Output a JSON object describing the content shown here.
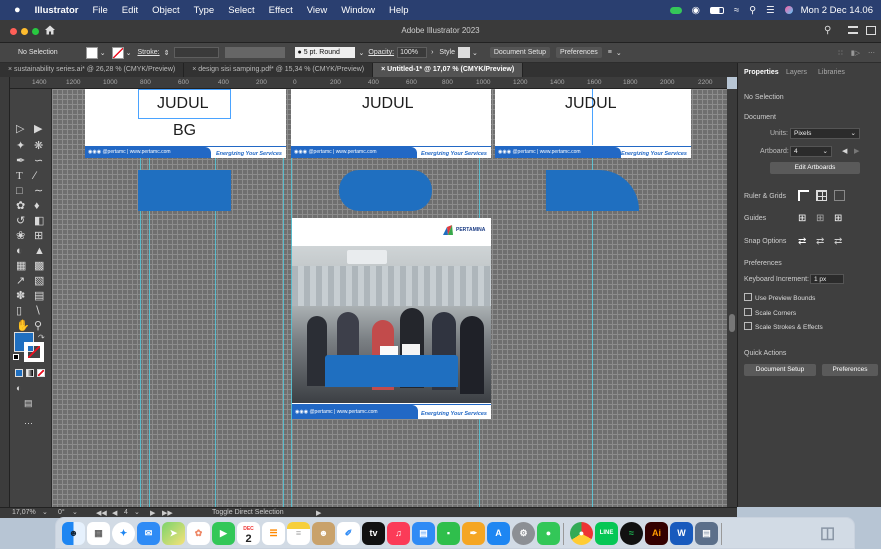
{
  "menubar": {
    "apple": "",
    "app_name": "Illustrator",
    "items": [
      "File",
      "Edit",
      "Object",
      "Type",
      "Select",
      "Effect",
      "View",
      "Window",
      "Help"
    ],
    "clock": "Mon 2 Dec 14.06"
  },
  "window": {
    "title": "Adobe Illustrator 2023"
  },
  "control_bar": {
    "selection": "No Selection",
    "stroke_label": "Stroke:",
    "brush": "5 pt. Round",
    "opacity_label": "Opacity:",
    "opacity_value": "100%",
    "style_label": "Style",
    "document_setup": "Document Setup",
    "preferences": "Preferences"
  },
  "tabs": [
    {
      "label": "sustainability series.ai* @ 26,28 % (CMYK/Preview)",
      "active": false
    },
    {
      "label": "design sisi samping.pdf* @ 15,34 % (CMYK/Preview)",
      "active": false
    },
    {
      "label": "Untitled-1* @ 17,07 % (CMYK/Preview)",
      "active": true
    }
  ],
  "ruler_labels": [
    "1400",
    "1200",
    "1000",
    "800",
    "600",
    "400",
    "200",
    "0",
    "200",
    "400",
    "600",
    "800",
    "1000",
    "1200",
    "1400",
    "1600",
    "1800",
    "2000",
    "2200"
  ],
  "artboards": {
    "top1_line1": "JUDUL",
    "top1_line2": "BG",
    "top2_text": "JUDUL",
    "top3_text": "JUDUL",
    "footer_social": "@pertamc | www.pertamc.com",
    "footer_tagline": "Energizing Your Services",
    "logo_text": "PERTAMINA"
  },
  "panel": {
    "tabs": [
      "Properties",
      "Layers",
      "Libraries"
    ],
    "no_selection": "No Selection",
    "document": "Document",
    "units_label": "Units:",
    "units_value": "Pixels",
    "artboard_label": "Artboard:",
    "artboard_value": "4",
    "edit_artboards": "Edit Artboards",
    "ruler_grids": "Ruler & Grids",
    "guides": "Guides",
    "snap_options": "Snap Options",
    "preferences": "Preferences",
    "keyboard_increment_label": "Keyboard Increment:",
    "keyboard_increment_value": "1 px",
    "use_preview_bounds": "Use Preview Bounds",
    "scale_corners": "Scale Corners",
    "scale_strokes": "Scale Strokes & Effects",
    "quick_actions": "Quick Actions",
    "document_setup_btn": "Document Setup",
    "preferences_btn": "Preferences"
  },
  "status": {
    "zoom": "17,07%",
    "rotation": "0°",
    "artboard_nav": "4",
    "tool_hint": "Toggle Direct Selection"
  },
  "dock": {
    "calendar_month": "DEC",
    "calendar_day": "2",
    "tv_label": "tv",
    "ai_label": "Ai",
    "word_label": "W",
    "line_label": "LINE"
  },
  "colors": {
    "accent_blue": "#1f6fc0",
    "menubar": "#2a3f70",
    "canvas": "#6f6f6f",
    "panel": "#3f3f3f"
  }
}
